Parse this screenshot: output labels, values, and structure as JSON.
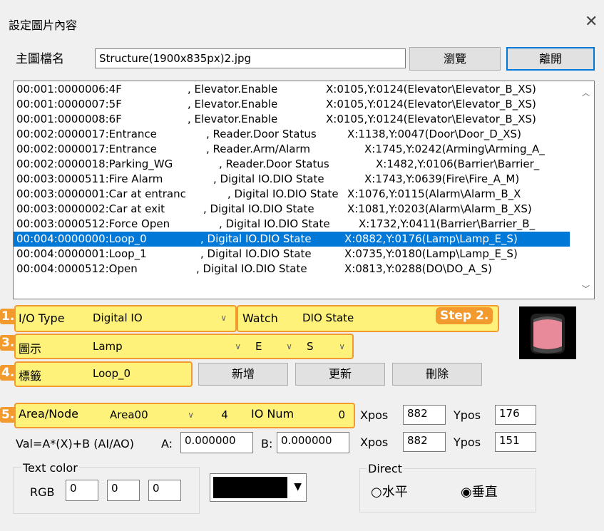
{
  "window": {
    "title": "設定圖片內容",
    "close_icon": "✕"
  },
  "main_file": {
    "label": "主圖檔名",
    "value": "Structure(1900x835px)2.jpg",
    "browse_label": "瀏覽",
    "exit_label": "離開"
  },
  "list": {
    "rows": [
      {
        "a": "00:001:0000006:4F",
        "b": ", Elevator.Enable",
        "c": "X:0105,Y:0124(Elevator\\Elevator_B_XS)"
      },
      {
        "a": "00:001:0000007:5F",
        "b": ", Elevator.Enable",
        "c": "X:0105,Y:0124(Elevator\\Elevator_B_XS)"
      },
      {
        "a": "00:001:0000008:6F",
        "b": ", Elevator.Enable",
        "c": "X:0105,Y:0124(Elevator\\Elevator_B_XS)"
      },
      {
        "a": "00:002:0000017:Entrance",
        "b": ", Reader.Door Status",
        "c": "X:1138,Y:0047(Door\\Door_D_XS)"
      },
      {
        "a": "00:002:0000017:Entrance",
        "b": ", Reader.Arm/Alarm",
        "c": "X:1745,Y:0242(Arming\\Arming_A_"
      },
      {
        "a": "00:002:0000018:Parking_WG",
        "b": ", Reader.Door Status",
        "c": "X:1482,Y:0106(Barrier\\Barrier_"
      },
      {
        "a": "00:003:0000511:Fire Alarm",
        "b": ", Digital IO.DIO State",
        "c": "X:1743,Y:0639(Fire\\Fire_A_M)"
      },
      {
        "a": "00:003:0000001:Car at entranc",
        "b": ", Digital IO.DIO State",
        "c": "X:1076,Y:0115(Alarm\\Alarm_B_X"
      },
      {
        "a": "00:003:0000002:Car at exit",
        "b": ", Digital IO.DIO State",
        "c": "X:1081,Y:0203(Alarm\\Alarm_B_XS)"
      },
      {
        "a": "00:003:0000512:Force Open",
        "b": ", Digital IO.DIO State",
        "c": "X:1732,Y:0411(Barrier\\Barrier_B_"
      },
      {
        "a": "00:004:0000000:Loop_0",
        "b": ", Digital IO.DIO State",
        "c": "X:0882,Y:0176(Lamp\\Lamp_E_S)"
      },
      {
        "a": "00:004:0000001:Loop_1",
        "b": ", Digital IO.DIO State",
        "c": "X:0735,Y:0180(Lamp\\Lamp_E_S)"
      },
      {
        "a": "00:004:0000512:Open",
        "b": ", Digital IO.DIO State",
        "c": "X:0813,Y:0288(DO\\DO_A_S)"
      }
    ]
  },
  "io": {
    "step": "1.",
    "label": "I/O Type",
    "value": "Digital IO"
  },
  "watch": {
    "label": "Watch",
    "value": "DIO State",
    "step_tag": "Step 2."
  },
  "display": {
    "step": "3.",
    "label": "圖示",
    "icon": "Lamp",
    "opt1": "E",
    "opt2": "S"
  },
  "tag": {
    "step": "4.",
    "label": "標籤",
    "value": "Loop_0",
    "add_label": "新增",
    "update_label": "更新",
    "delete_label": "刪除"
  },
  "area": {
    "step": "5.",
    "label": "Area/Node",
    "area_value": "Area00",
    "node_value": "4",
    "io_num_label": "IO Num",
    "io_num_value": "0"
  },
  "pos1": {
    "xlabel": "Xpos",
    "xval": "882",
    "ylabel": "Ypos",
    "yval": "176"
  },
  "formula": {
    "label": "Val=A*(X)+B (AI/AO)",
    "a_label": "A:",
    "a_value": "0.000000",
    "b_label": "B:",
    "b_value": "0.000000"
  },
  "pos2": {
    "xlabel": "Xpos",
    "xval": "882",
    "ylabel": "Ypos",
    "yval": "151"
  },
  "textcolor": {
    "group_label": "Text color",
    "rgb_label": "RGB",
    "r": "0",
    "g": "0",
    "b": "0",
    "swatch": "#000000"
  },
  "direct": {
    "group_label": "Direct",
    "horizontal": "水平",
    "vertical": "垂直",
    "selected": "vertical"
  },
  "colors": {
    "highlight": "#fff27a",
    "highlight_border": "#f39a2e",
    "selection": "#0078d7"
  }
}
